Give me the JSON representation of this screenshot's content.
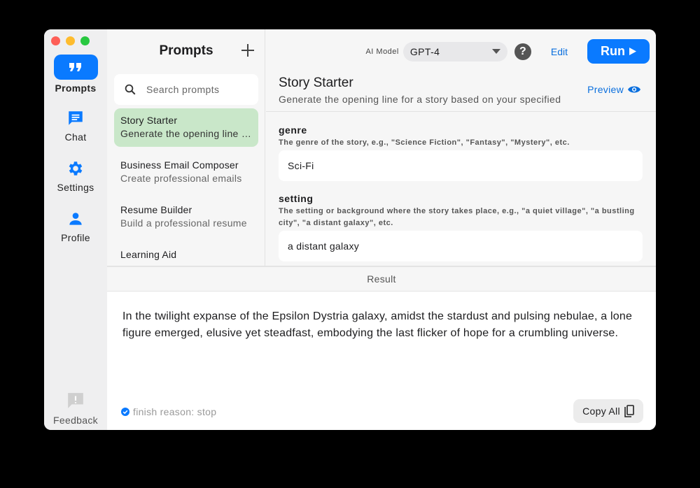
{
  "app": {
    "accent_color": "#0a7aff",
    "selected_item_color": "#c9e7c9"
  },
  "rail": {
    "items": [
      {
        "label": "Prompts",
        "icon": "quote-icon",
        "active": true
      },
      {
        "label": "Chat",
        "icon": "chat-bubble-icon",
        "active": false
      },
      {
        "label": "Settings",
        "icon": "gear-icon",
        "active": false
      },
      {
        "label": "Profile",
        "icon": "person-icon",
        "active": false
      }
    ],
    "feedback_label": "Feedback"
  },
  "prompts": {
    "title": "Prompts",
    "search_placeholder": "Search prompts",
    "items": [
      {
        "title": "Story Starter",
        "description": "Generate the opening line for a story based on your specified",
        "selected": true
      },
      {
        "title": "Business Email Composer",
        "description": "Create professional emails",
        "selected": false
      },
      {
        "title": "Resume Builder",
        "description": "Build a professional resume",
        "selected": false
      },
      {
        "title": "Learning Aid",
        "description": "",
        "selected": false
      }
    ]
  },
  "toolbar": {
    "model_label": "AI Model",
    "model_value": "GPT-4",
    "help_label": "?",
    "edit_label": "Edit",
    "run_label": "Run"
  },
  "detail": {
    "title": "Story Starter",
    "description": "Generate the opening line for a story based on your specified",
    "preview_label": "Preview",
    "fields": [
      {
        "name": "genre",
        "hint": "The genre of the story, e.g., \"Science Fiction\", \"Fantasy\", \"Mystery\", etc.",
        "value": "Sci-Fi"
      },
      {
        "name": "setting",
        "hint": "The setting or background where the story takes place, e.g., \"a quiet village\", \"a bustling city\", \"a distant galaxy\", etc.",
        "value": "a distant galaxy"
      }
    ]
  },
  "result": {
    "header": "Result",
    "text": "In the twilight expanse of the Epsilon Dystria galaxy, amidst the stardust and pulsing nebulae, a lone figure emerged, elusive yet steadfast, embodying the last flicker of hope for a crumbling universe.",
    "finish_reason": "finish reason: stop",
    "copy_label": "Copy All"
  }
}
